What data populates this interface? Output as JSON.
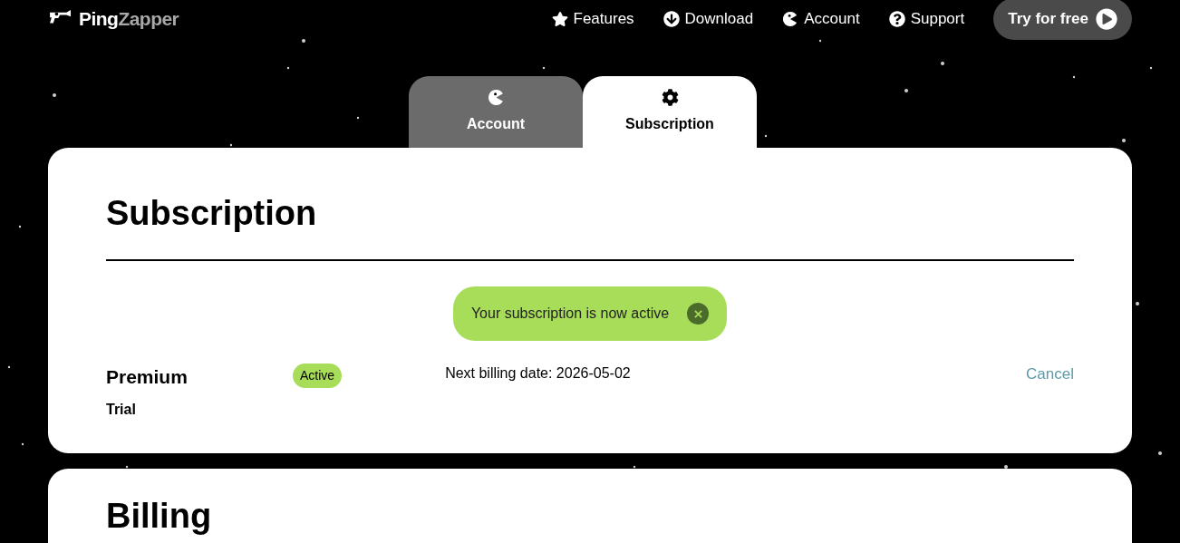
{
  "logo": {
    "first": "Ping",
    "second": "Zapper"
  },
  "nav": [
    {
      "label": "Features",
      "kind": "star"
    },
    {
      "label": "Download",
      "kind": "download"
    },
    {
      "label": "Account",
      "kind": "pac"
    },
    {
      "label": "Support",
      "kind": "help"
    }
  ],
  "cta": {
    "label": "Try for free"
  },
  "tabs": [
    {
      "label": "Account",
      "kind": "pac",
      "selected": false
    },
    {
      "label": "Subscription",
      "kind": "gear",
      "selected": true
    }
  ],
  "subscription": {
    "title": "Subscription",
    "toast": {
      "message": "Your subscription is now active"
    },
    "plan": {
      "name": "Premium",
      "type": "Trial",
      "status": "Active",
      "billing": "Next billing date: 2026-05-02",
      "action": "Cancel"
    }
  },
  "billing": {
    "title": "Billing"
  }
}
